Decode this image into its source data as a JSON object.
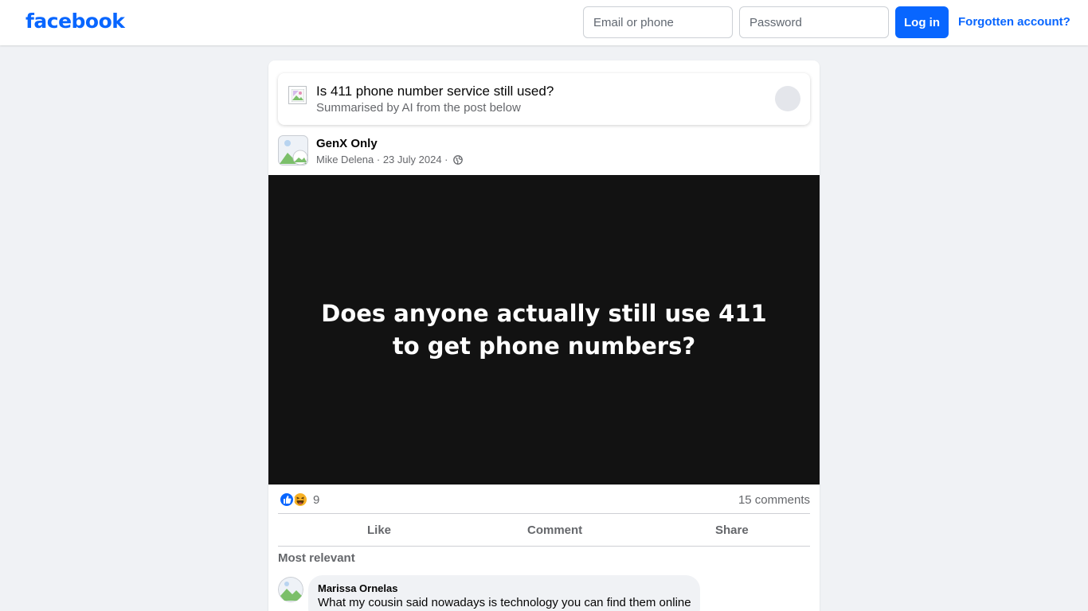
{
  "header": {
    "logo": "facebook",
    "email_placeholder": "Email or phone",
    "password_placeholder": "Password",
    "login_label": "Log in",
    "forgot_label": "Forgotten account?"
  },
  "ai_summary": {
    "title": "Is 411 phone number service still used?",
    "subtitle": "Summarised by AI from the post below"
  },
  "post": {
    "group": "GenX Only",
    "author": "Mike Delena",
    "date": "23 July 2024",
    "separator": " · ",
    "image_text": "Does anyone actually still use 411 to get phone numbers?",
    "reaction_count": "9",
    "comments_count": "15 comments",
    "actions": {
      "like": "Like",
      "comment": "Comment",
      "share": "Share"
    }
  },
  "comments": {
    "sort_label": "Most relevant",
    "items": [
      {
        "author": "Marissa Ornelas",
        "text": "What my cousin said nowadays is technology you can find them online"
      }
    ]
  },
  "colors": {
    "brand": "#0866ff",
    "background": "#f0f2f5",
    "media_bg": "#121212"
  }
}
